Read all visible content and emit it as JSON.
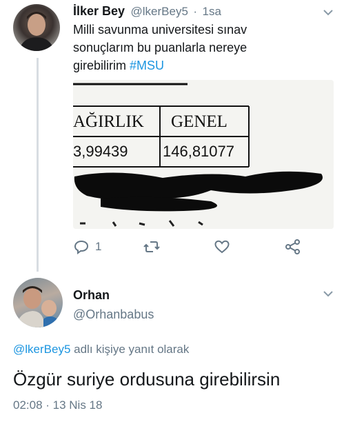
{
  "tweet": {
    "author_name": "İlker Bey",
    "handle": "@lkerBey5",
    "separator": "·",
    "time": "1sa",
    "text_line1": "Milli savunma universitesi sınav",
    "text_line2": "sonuçlarım bu puanlarla nereye",
    "text_line3_plain": "girebilirim ",
    "hashtag": "#MSU",
    "media": {
      "col1_header": "AĞIRLIK",
      "col2_header": "GENEL",
      "col1_value": "3,99439",
      "col2_value": "146,81077"
    },
    "reply_count": "1"
  },
  "reply": {
    "author_name": "Orhan",
    "handle": "@Orhanbabus",
    "replying_to_handle": "@lkerBey5",
    "replying_to_suffix": " adlı kişiye yanıt olarak",
    "text": "Özgür suriye ordusuna girebilirsin",
    "timestamp": "02:08 · 13 Nis 18"
  },
  "colors": {
    "link": "#1b95e0",
    "muted": "#657786",
    "text": "#14171a"
  }
}
